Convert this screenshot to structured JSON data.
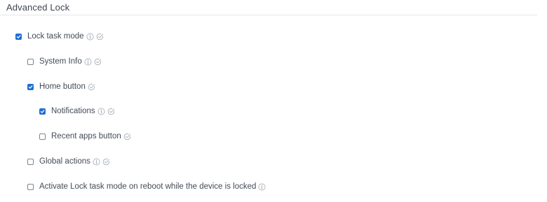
{
  "section": {
    "title": "Advanced Lock"
  },
  "options": [
    {
      "id": "lock_task_mode",
      "label": "Lock task mode",
      "checked": true,
      "icons": [
        "info-icon",
        "verified-check-icon"
      ]
    },
    {
      "id": "system_info",
      "label": "System Info",
      "checked": false,
      "icons": [
        "info-icon",
        "verified-check-icon"
      ]
    },
    {
      "id": "home_button",
      "label": "Home button",
      "checked": true,
      "icons": [
        "verified-check-icon"
      ]
    },
    {
      "id": "notifications",
      "label": "Notifications",
      "checked": true,
      "icons": [
        "info-icon",
        "verified-check-icon"
      ]
    },
    {
      "id": "recent_apps_button",
      "label": "Recent apps button",
      "checked": false,
      "icons": [
        "verified-check-icon"
      ]
    },
    {
      "id": "global_actions",
      "label": "Global actions",
      "checked": false,
      "icons": [
        "info-icon",
        "verified-check-icon"
      ]
    },
    {
      "id": "activate_on_reboot",
      "label": "Activate Lock task mode on reboot while the device is locked",
      "checked": false,
      "icons": [
        "info-icon"
      ]
    }
  ],
  "colors": {
    "checkbox_checked": "#1f6fd1",
    "icon_gray": "#a3a9b1",
    "divider": "#e3e6ea"
  }
}
